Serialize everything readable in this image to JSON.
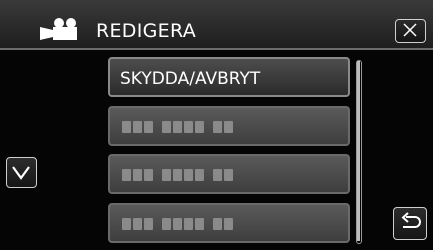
{
  "header": {
    "title": "REDIGERA",
    "mode_icon": "movie-camera-icon",
    "close_icon": "close-icon"
  },
  "menu": {
    "items": [
      {
        "label": "SKYDDA/AVBRYT",
        "state": "active"
      },
      {
        "label": "",
        "state": "dim"
      },
      {
        "label": "",
        "state": "dim"
      },
      {
        "label": "",
        "state": "dim"
      }
    ]
  },
  "controls": {
    "down_icon": "chevron-down-icon",
    "back_icon": "return-arrow-icon"
  },
  "colors": {
    "background": "#050505",
    "header": "#2b2b2b",
    "button_border": "#cfcfcf",
    "dim_item": "#4a4a4a",
    "text": "#ffffff"
  }
}
